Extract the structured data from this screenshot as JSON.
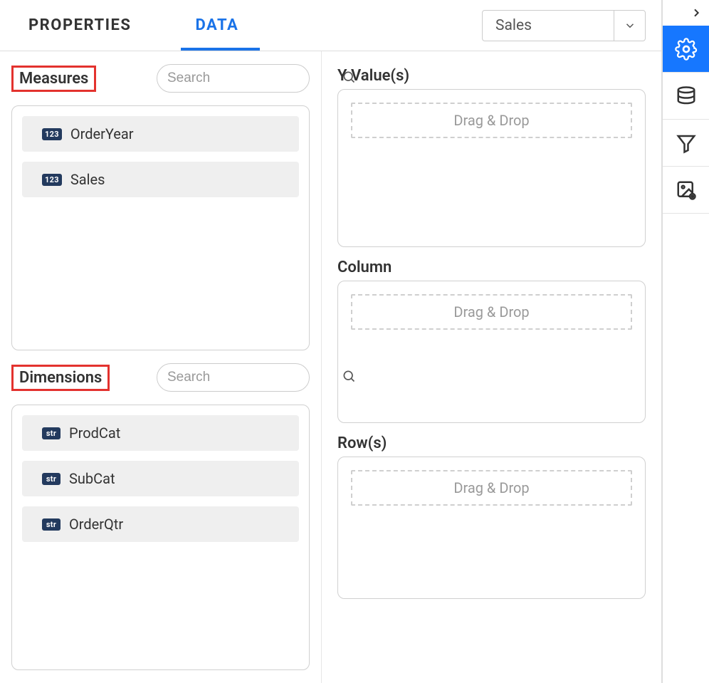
{
  "tabs": {
    "properties": "PROPERTIES",
    "data": "DATA"
  },
  "datasource": {
    "selected": "Sales"
  },
  "measures": {
    "title": "Measures",
    "search_placeholder": "Search",
    "items": [
      {
        "badge": "123",
        "label": "OrderYear"
      },
      {
        "badge": "123",
        "label": "Sales"
      }
    ]
  },
  "dimensions": {
    "title": "Dimensions",
    "search_placeholder": "Search",
    "items": [
      {
        "badge": "str",
        "label": "ProdCat"
      },
      {
        "badge": "str",
        "label": "SubCat"
      },
      {
        "badge": "str",
        "label": "OrderQtr"
      }
    ]
  },
  "dropzones": {
    "yvalues": {
      "title": "Y Value(s)",
      "placeholder": "Drag & Drop"
    },
    "column": {
      "title": "Column",
      "placeholder": "Drag & Drop"
    },
    "rows": {
      "title": "Row(s)",
      "placeholder": "Drag & Drop"
    }
  }
}
